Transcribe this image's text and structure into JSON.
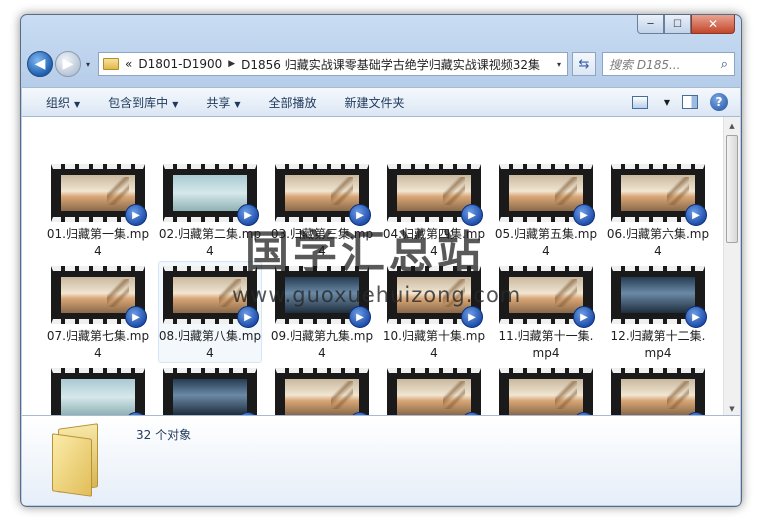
{
  "window": {
    "controls": {
      "minimize": "─",
      "maximize": "☐",
      "close": "✕"
    }
  },
  "nav": {
    "back": "◀",
    "forward": "▶",
    "history": "▾"
  },
  "address": {
    "overflow": "«",
    "crumbs": [
      "D1801-D1900",
      "D1856 归藏实战课零基础学古绝学归藏实战课视频32集"
    ],
    "separator": "▶",
    "dropdown": "▾",
    "refresh": "⇆"
  },
  "search": {
    "placeholder": "搜索 D185...",
    "icon": "⌕"
  },
  "toolbar": {
    "organize": "组织",
    "include_in_library": "包含到库中",
    "share": "共享",
    "play_all": "全部播放",
    "new_folder": "新建文件夹",
    "arrow": "▼",
    "help": "?"
  },
  "files": [
    {
      "label": "01.归藏第一集.mp4",
      "thumb": "sky"
    },
    {
      "label": "02.归藏第二集.mp4",
      "thumb": "sea"
    },
    {
      "label": "03.归藏第三集.mp4",
      "thumb": "sky"
    },
    {
      "label": "04.归藏第四集.mp4",
      "thumb": "sky"
    },
    {
      "label": "05.归藏第五集.mp4",
      "thumb": "sky"
    },
    {
      "label": "06.归藏第六集.mp4",
      "thumb": "sky"
    },
    {
      "label": "07.归藏第七集.mp4",
      "thumb": "sky"
    },
    {
      "label": "08.归藏第八集.mp4",
      "thumb": "sky"
    },
    {
      "label": "09.归藏第九集.mp4",
      "thumb": "dark"
    },
    {
      "label": "10.归藏第十集.mp4",
      "thumb": "sky"
    },
    {
      "label": "11.归藏第十一集.mp4",
      "thumb": "sky"
    },
    {
      "label": "12.归藏第十二集.mp4",
      "thumb": "dark"
    },
    {
      "label": "",
      "thumb": "sea"
    },
    {
      "label": "",
      "thumb": "dark"
    },
    {
      "label": "",
      "thumb": "sky"
    },
    {
      "label": "",
      "thumb": "sky"
    },
    {
      "label": "",
      "thumb": "sky"
    },
    {
      "label": "",
      "thumb": "sky"
    }
  ],
  "play_badge": "▶",
  "watermark": {
    "cn": "国学汇总站",
    "url": "www.guoxuehuizong.com"
  },
  "details": {
    "count": "32 个对象"
  },
  "scrollbar": {
    "up": "▲",
    "down": "▼"
  }
}
